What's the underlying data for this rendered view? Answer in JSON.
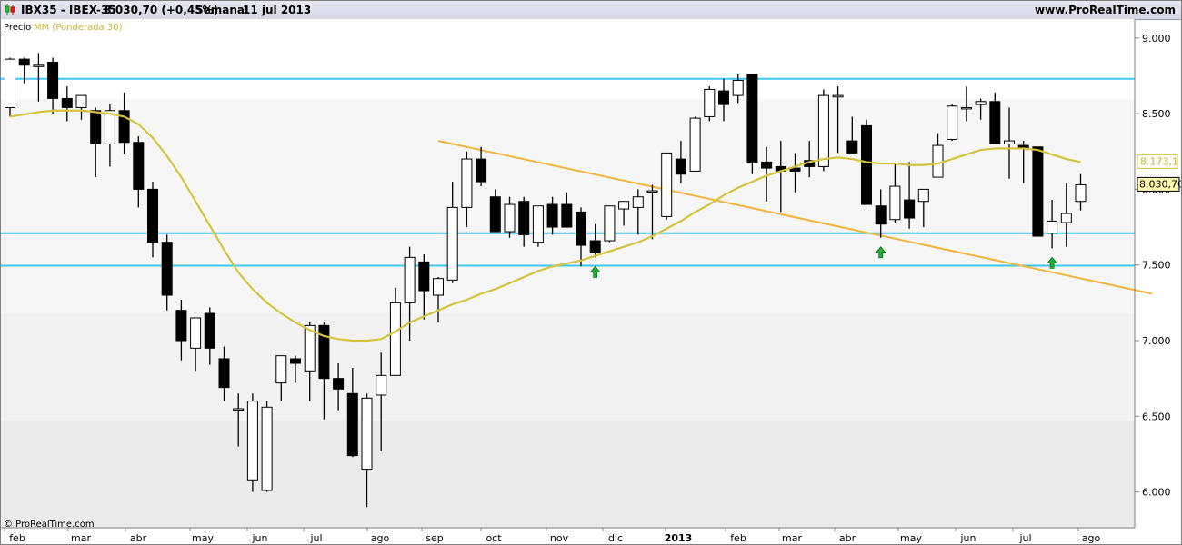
{
  "header": {
    "symbol": "IBX35 - IBEX-35",
    "last": "8.030,70 (+0,45%)",
    "period": "Semanal",
    "date": "11 jul 2013",
    "site": "www.ProRealTime.com"
  },
  "legend": {
    "price": "Precio",
    "ma": "MM (Ponderada 30)"
  },
  "footer": "© ProRealTime.com",
  "colors": {
    "up": "#ffffff",
    "down": "#000000",
    "ma": "#d4c43c",
    "hline": "#3ec8f0",
    "trend": "#f4b43c",
    "arrow": "#1fae3a"
  },
  "chart_data": {
    "type": "candlestick",
    "period": "weekly",
    "y_axis": {
      "ticks": [
        "9.000",
        "8.500",
        "8.000",
        "7.500",
        "7.000",
        "6.500",
        "6.000"
      ],
      "range": [
        5780,
        9100
      ]
    },
    "x_labels": [
      "feb",
      "mar",
      "abr",
      "may",
      "jun",
      "jul",
      "ago",
      "sep",
      "oct",
      "nov",
      "dic",
      "2013",
      "feb",
      "mar",
      "abr",
      "may",
      "jun",
      "jul",
      "ago"
    ],
    "last_price_label": "8.030,70",
    "ma_label": "8.173,1",
    "candles": [
      [
        8540,
        8870,
        8480,
        8860
      ],
      [
        8860,
        8870,
        8700,
        8820
      ],
      [
        8820,
        8900,
        8580,
        8820
      ],
      [
        8840,
        8870,
        8500,
        8600
      ],
      [
        8600,
        8680,
        8450,
        8540
      ],
      [
        8540,
        8620,
        8460,
        8620
      ],
      [
        8520,
        8540,
        8080,
        8300
      ],
      [
        8300,
        8560,
        8150,
        8520
      ],
      [
        8520,
        8640,
        8230,
        8310
      ],
      [
        8310,
        8350,
        7880,
        8000
      ],
      [
        8000,
        8050,
        7550,
        7650
      ],
      [
        7650,
        7700,
        7200,
        7300
      ],
      [
        7200,
        7270,
        6870,
        7000
      ],
      [
        6950,
        7100,
        6800,
        7150
      ],
      [
        7180,
        7220,
        6840,
        6950
      ],
      [
        6880,
        6960,
        6600,
        6690
      ],
      [
        6550,
        6650,
        6300,
        6550
      ],
      [
        6080,
        6650,
        6000,
        6600
      ],
      [
        6010,
        6600,
        6000,
        6560
      ],
      [
        6720,
        6900,
        6600,
        6900
      ],
      [
        6880,
        6900,
        6720,
        6850
      ],
      [
        6800,
        7120,
        6600,
        7100
      ],
      [
        7100,
        7120,
        6480,
        6750
      ],
      [
        6750,
        6850,
        6540,
        6680
      ],
      [
        6650,
        6820,
        6230,
        6240
      ],
      [
        6150,
        6650,
        5900,
        6620
      ],
      [
        6640,
        6920,
        6270,
        6770
      ],
      [
        6770,
        7350,
        6780,
        7250
      ],
      [
        7250,
        7620,
        7000,
        7550
      ],
      [
        7520,
        7570,
        7140,
        7330
      ],
      [
        7300,
        7420,
        7120,
        7410
      ],
      [
        7400,
        8050,
        7380,
        7880
      ],
      [
        7880,
        8250,
        7750,
        8200
      ],
      [
        8200,
        8280,
        8020,
        8050
      ],
      [
        7950,
        8000,
        7720,
        7720
      ],
      [
        7720,
        7950,
        7680,
        7900
      ],
      [
        7920,
        7950,
        7620,
        7700
      ],
      [
        7650,
        7860,
        7620,
        7890
      ],
      [
        7900,
        7950,
        7700,
        7750
      ],
      [
        7900,
        7980,
        7750,
        7750
      ],
      [
        7850,
        7880,
        7490,
        7630
      ],
      [
        7660,
        7770,
        7550,
        7580
      ],
      [
        7660,
        7860,
        7650,
        7890
      ],
      [
        7870,
        7900,
        7760,
        7920
      ],
      [
        7880,
        8000,
        7700,
        7950
      ],
      [
        7990,
        8030,
        7670,
        7990
      ],
      [
        7820,
        8200,
        7800,
        8240
      ],
      [
        8200,
        8320,
        8040,
        8100
      ],
      [
        8120,
        8480,
        8120,
        8470
      ],
      [
        8480,
        8680,
        8450,
        8660
      ],
      [
        8650,
        8730,
        8450,
        8560
      ],
      [
        8620,
        8760,
        8570,
        8720
      ],
      [
        8760,
        8760,
        8100,
        8180
      ],
      [
        8180,
        8280,
        7920,
        8140
      ],
      [
        8150,
        8320,
        7850,
        8120
      ],
      [
        8140,
        8240,
        7980,
        8120
      ],
      [
        8190,
        8320,
        8080,
        8150
      ],
      [
        8150,
        8660,
        8120,
        8620
      ],
      [
        8610,
        8680,
        8240,
        8620
      ],
      [
        8320,
        8480,
        8270,
        8240
      ],
      [
        8420,
        8460,
        7900,
        7900
      ],
      [
        7890,
        8000,
        7680,
        7770
      ],
      [
        7800,
        8170,
        7780,
        8020
      ],
      [
        7930,
        8180,
        7740,
        7810
      ],
      [
        7920,
        8000,
        7750,
        8000
      ],
      [
        8080,
        8370,
        8080,
        8290
      ],
      [
        8330,
        8560,
        8320,
        8550
      ],
      [
        8540,
        8680,
        8450,
        8540
      ],
      [
        8560,
        8600,
        8460,
        8580
      ],
      [
        8580,
        8640,
        8500,
        8300
      ],
      [
        8300,
        8540,
        8070,
        8320
      ],
      [
        8290,
        8320,
        8040,
        8270
      ],
      [
        8280,
        8220,
        7850,
        7690
      ],
      [
        7710,
        7930,
        7610,
        7790
      ],
      [
        7780,
        8040,
        7620,
        7840
      ],
      [
        7920,
        8100,
        7860,
        8030
      ]
    ],
    "moving_average": [
      8480,
      8495,
      8510,
      8520,
      8520,
      8520,
      8510,
      8500,
      8480,
      8430,
      8340,
      8220,
      8080,
      7920,
      7760,
      7600,
      7450,
      7340,
      7250,
      7180,
      7120,
      7070,
      7030,
      7010,
      7000,
      7000,
      7010,
      7060,
      7120,
      7160,
      7200,
      7240,
      7270,
      7310,
      7340,
      7380,
      7420,
      7460,
      7490,
      7510,
      7530,
      7560,
      7590,
      7620,
      7650,
      7690,
      7740,
      7790,
      7850,
      7900,
      7960,
      8010,
      8050,
      8090,
      8120,
      8150,
      8180,
      8200,
      8210,
      8200,
      8180,
      8170,
      8170,
      8160,
      8160,
      8170,
      8200,
      8230,
      8260,
      8270,
      8270,
      8270,
      8260,
      8230,
      8200,
      8180
    ],
    "horizontal_lines": [
      8730,
      7710,
      7495
    ],
    "trendline": {
      "from": [
        30,
        8320
      ],
      "to": [
        80,
        7310
      ]
    },
    "signal_arrows": [
      41,
      61,
      73
    ]
  }
}
